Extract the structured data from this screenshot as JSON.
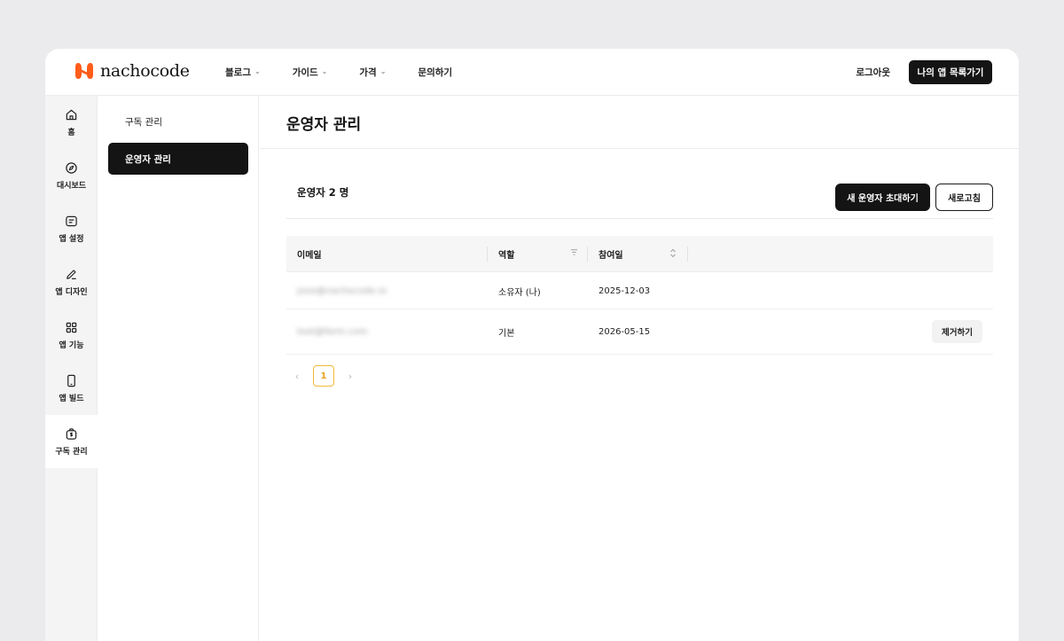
{
  "brand": {
    "name": "nachocode",
    "accent": "#ff5c1a"
  },
  "nav": {
    "links": [
      {
        "label": "블로그",
        "dropdown": true
      },
      {
        "label": "가이드",
        "dropdown": true
      },
      {
        "label": "가격",
        "dropdown": true
      },
      {
        "label": "문의하기",
        "dropdown": false
      }
    ],
    "logout": "로그아웃",
    "my_apps": "나의 앱 목록가기"
  },
  "rail": {
    "items": [
      {
        "label": "홈",
        "icon": "home-icon"
      },
      {
        "label": "대시보드",
        "icon": "compass-icon"
      },
      {
        "label": "앱 설정",
        "icon": "settings-card-icon"
      },
      {
        "label": "앱 디자인",
        "icon": "pen-icon"
      },
      {
        "label": "앱 기능",
        "icon": "grid-icon"
      },
      {
        "label": "앱 빌드",
        "icon": "phone-icon"
      },
      {
        "label": "구독 관리",
        "icon": "wallet-icon",
        "active": true
      }
    ]
  },
  "subnav": {
    "items": [
      {
        "label": "구독 관리",
        "active": false
      },
      {
        "label": "운영자 관리",
        "active": true
      }
    ]
  },
  "page": {
    "title": "운영자 관리",
    "count_title": "운영자 2 명",
    "invite_label": "새 운영자 초대하기",
    "refresh_label": "새로고침"
  },
  "table": {
    "columns": [
      "이메일",
      "역할",
      "참여일"
    ],
    "rows": [
      {
        "email": "jooo@nachocode.io",
        "role": "소유자 (나)",
        "joined": "2025-12-03",
        "action": ""
      },
      {
        "email": "test@farm.com",
        "role": "기본",
        "joined": "2026-05-15",
        "action": "제거하기"
      }
    ]
  },
  "pagination": {
    "prev": "‹",
    "current": "1",
    "next": "›"
  }
}
